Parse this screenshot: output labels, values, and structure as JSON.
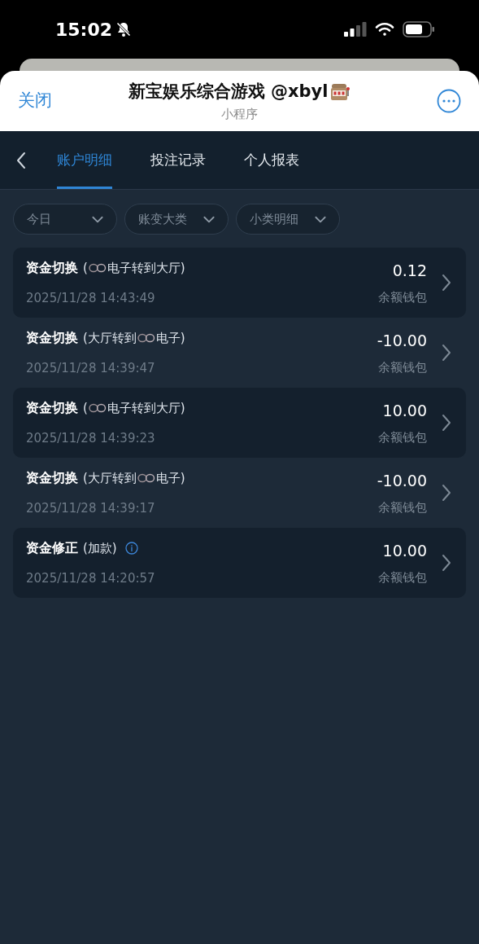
{
  "status_bar": {
    "time": "15:02"
  },
  "header": {
    "close": "关闭",
    "title": "新宝娱乐综合游戏 @xbyl",
    "subtitle": "小程序"
  },
  "tabs": [
    {
      "label": "账户明细",
      "selected": true
    },
    {
      "label": "投注记录",
      "selected": false
    },
    {
      "label": "个人报表",
      "selected": false
    }
  ],
  "filters": [
    "今日",
    "账变大类",
    "小类明细"
  ],
  "records": [
    {
      "type": "资金切换",
      "detail": [
        {
          "kind": "text",
          "text": "("
        },
        {
          "kind": "logo"
        },
        {
          "kind": "text",
          "text": "电子转到大厅)"
        }
      ],
      "time": "2025/11/28 14:43:49",
      "amount": "0.12",
      "wallet": "余额钱包"
    },
    {
      "type": "资金切换",
      "detail": [
        {
          "kind": "text",
          "text": "(大厅转到"
        },
        {
          "kind": "logo"
        },
        {
          "kind": "text",
          "text": "电子)"
        }
      ],
      "time": "2025/11/28 14:39:47",
      "amount": "-10.00",
      "wallet": "余额钱包"
    },
    {
      "type": "资金切换",
      "detail": [
        {
          "kind": "text",
          "text": "("
        },
        {
          "kind": "logo"
        },
        {
          "kind": "text",
          "text": "电子转到大厅)"
        }
      ],
      "time": "2025/11/28 14:39:23",
      "amount": "10.00",
      "wallet": "余额钱包"
    },
    {
      "type": "资金切换",
      "detail": [
        {
          "kind": "text",
          "text": "(大厅转到"
        },
        {
          "kind": "logo"
        },
        {
          "kind": "text",
          "text": "电子)"
        }
      ],
      "time": "2025/11/28 14:39:17",
      "amount": "-10.00",
      "wallet": "余额钱包"
    },
    {
      "type": "资金修正",
      "detail": [
        {
          "kind": "text",
          "text": "(加款)"
        },
        {
          "kind": "info"
        }
      ],
      "time": "2025/11/28 14:20:57",
      "amount": "10.00",
      "wallet": "余额钱包"
    }
  ]
}
